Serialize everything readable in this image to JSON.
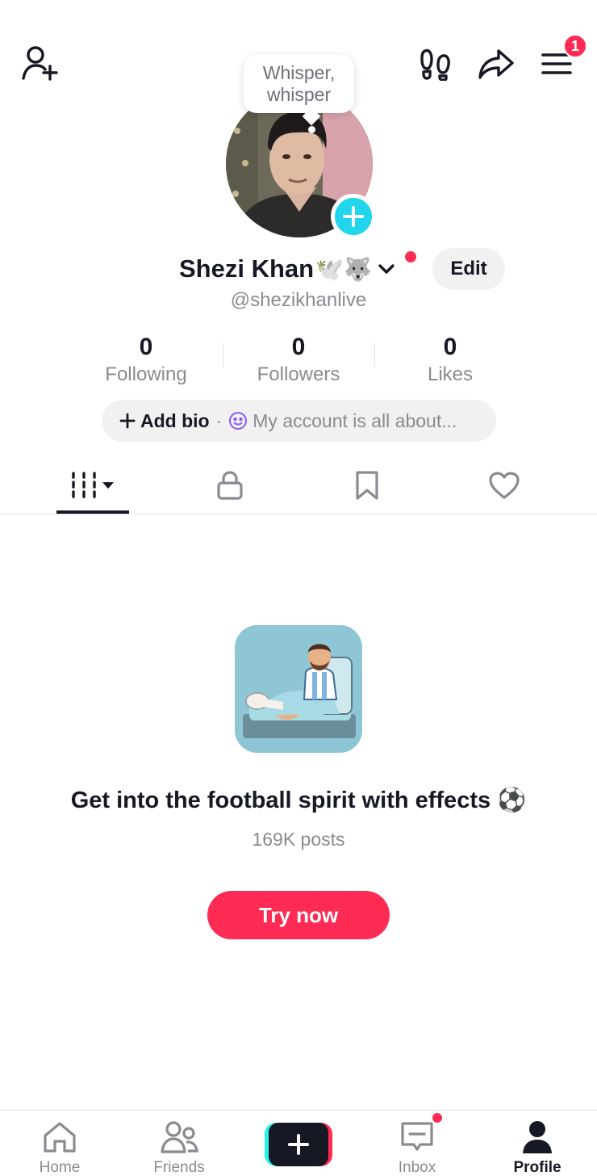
{
  "top_bar": {
    "icons": [
      "add-friend-icon",
      "footprints-icon",
      "share-icon",
      "menu-icon"
    ],
    "menu_badge": "1"
  },
  "profile": {
    "bubble_text_line1": "Whisper,",
    "bubble_text_line2": "whisper",
    "name": "Shezi Khan",
    "name_emojis": "🕊️🐺",
    "handle": "@shezikhanlive",
    "edit_label": "Edit"
  },
  "stats": [
    {
      "value": "0",
      "label": "Following"
    },
    {
      "value": "0",
      "label": "Followers"
    },
    {
      "value": "0",
      "label": "Likes"
    }
  ],
  "bio": {
    "add_label": "Add bio",
    "separator": "·",
    "hint": "My account is all about..."
  },
  "tabs": [
    "videos-grid-icon",
    "lock-icon",
    "bookmark-icon",
    "heart-icon"
  ],
  "promo": {
    "title": "Get into the football spirit with effects ⚽",
    "subtitle": "169K posts",
    "button": "Try now"
  },
  "bottom_nav": [
    {
      "label": "Home",
      "icon": "home-icon"
    },
    {
      "label": "Friends",
      "icon": "friends-icon"
    },
    {
      "label": "",
      "icon": "create-icon"
    },
    {
      "label": "Inbox",
      "icon": "inbox-icon"
    },
    {
      "label": "Profile",
      "icon": "profile-icon"
    }
  ],
  "colors": {
    "accent": "#fe2c55",
    "cyan": "#20d5ec",
    "text": "#161823",
    "muted": "#8a8b91"
  }
}
